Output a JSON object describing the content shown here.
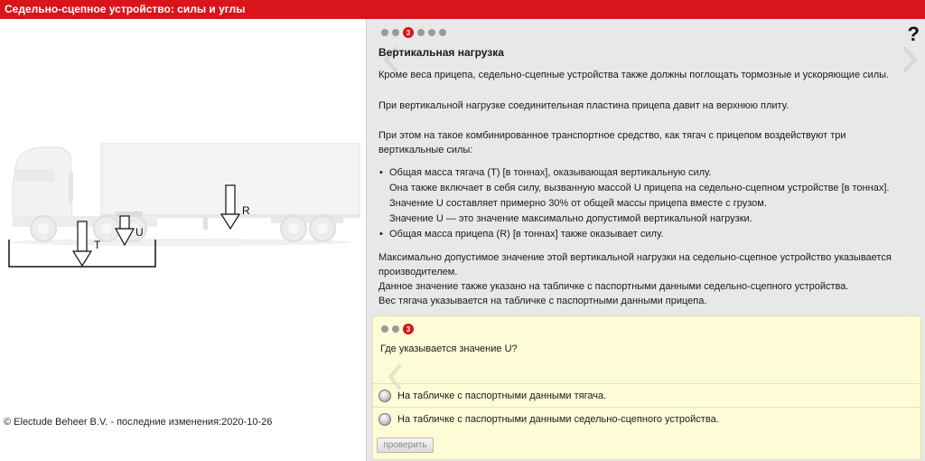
{
  "window": {
    "title": "Седельно-сцепное устройство: силы и углы"
  },
  "diagram": {
    "label_r": "R",
    "label_u": "U",
    "label_t": "T"
  },
  "footer": {
    "copyright": "© Electude Beheer B.V. - последние изменения:2020-10-26"
  },
  "lesson": {
    "pager": {
      "current_page": "3",
      "total_pages": 6
    },
    "help_icon": "?",
    "title": "Вертикальная нагрузка",
    "paragraphs": [
      "Кроме веса прицепа, седельно-сцепные устройства также должны поглощать тормозные и ускоряющие силы.",
      "При вертикальной нагрузке соединительная пластина прицепа давит на верхнюю плиту.",
      "При этом на такое комбинированное транспортное средство, как тягач с прицепом воздействуют три вертикальные силы:"
    ],
    "bullets": [
      {
        "lines": [
          "Общая масса тягача (T) [в тоннах], оказывающая вертикальную силу.",
          "Она также включает в себя силу, вызванную массой U прицепа на седельно-сцепном устройстве [в тоннах].",
          "Значение U составляет примерно 30% от общей массы прицепа вместе с грузом.",
          "Значение U — это значение максимально допустимой вертикальной нагрузки."
        ]
      },
      {
        "lines": [
          "Общая масса прицепа (R) [в тоннах] также оказывает силу."
        ]
      }
    ],
    "closing_lines": [
      "Максимально допустимое значение этой вертикальной нагрузки на седельно-сцепное устройство указывается производителем.",
      "Данное значение также указано на табличке с паспортными данными седельно-сцепного устройства.",
      "Вес тягача указывается на табличке с паспортными данными прицепа."
    ]
  },
  "quiz": {
    "pager": {
      "current_page": "3",
      "total_pages": 3
    },
    "question": "Где указывается значение U?",
    "options": [
      "На табличке с паспортными данными тягача.",
      "На табличке с паспортными данными седельно-сцепного устройства."
    ],
    "check_button": "проверить"
  },
  "colors": {
    "brand_red": "#d9141b",
    "panel_gray": "#e8e8e8",
    "quiz_yellow": "#fdfcd6"
  }
}
